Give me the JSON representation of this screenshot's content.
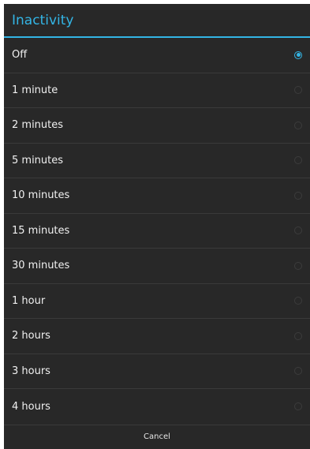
{
  "dialog": {
    "title": "Inactivity",
    "cancel_label": "Cancel",
    "accent_color": "#33b5e5",
    "options": [
      {
        "label": "Off",
        "selected": true
      },
      {
        "label": "1 minute",
        "selected": false
      },
      {
        "label": "2 minutes",
        "selected": false
      },
      {
        "label": "5 minutes",
        "selected": false
      },
      {
        "label": "10 minutes",
        "selected": false
      },
      {
        "label": "15 minutes",
        "selected": false
      },
      {
        "label": "30 minutes",
        "selected": false
      },
      {
        "label": "1 hour",
        "selected": false
      },
      {
        "label": "2 hours",
        "selected": false
      },
      {
        "label": "3 hours",
        "selected": false
      },
      {
        "label": "4 hours",
        "selected": false
      }
    ]
  }
}
